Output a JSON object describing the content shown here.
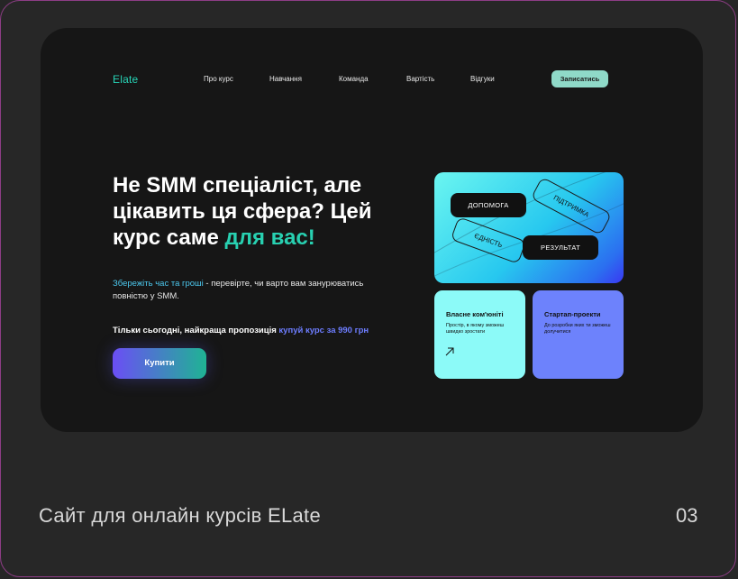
{
  "site": {
    "logo": "Elate",
    "nav": [
      "Про курс",
      "Навчання",
      "Команда",
      "Вартість",
      "Відгуки"
    ],
    "signup_label": "Записатись"
  },
  "hero": {
    "title_main": "Не SMM спеціаліст, але цікавить ця сфера? Цей курс саме ",
    "title_accent": "для вас!",
    "desc_accent": "Збережіть час та гроші",
    "desc_rest": " - перевірте, чи варто вам занурюватись повністю у SMM.",
    "offer_main": "Тільки сьогодні, найкраща пропозиція ",
    "offer_accent": "купуй курс за 990 грн",
    "buy_label": "Купити"
  },
  "card_main": {
    "pills": [
      "ДОПОМОГА",
      "РЕЗУЛЬТАТ"
    ],
    "outline_pills": [
      "ПІДТРИМКА",
      "ЄДНІСТЬ"
    ]
  },
  "cards": [
    {
      "title": "Власне ком'юніті",
      "text": "Простір, в якому зможеш швидко зростати"
    },
    {
      "title": "Стартап-проекти",
      "text": "До розробки яких ти зможеш долучитися"
    }
  ],
  "caption": "Сайт для онлайн курсів ELate",
  "number": "03",
  "colors": {
    "accent_green": "#28d0b1",
    "accent_cyan": "#4cc8ee",
    "accent_violet": "#6d7dff",
    "signup_bg": "#8fd9c8",
    "card_a_bg": "#8cfaf8",
    "card_b_bg": "#6d82fc"
  }
}
